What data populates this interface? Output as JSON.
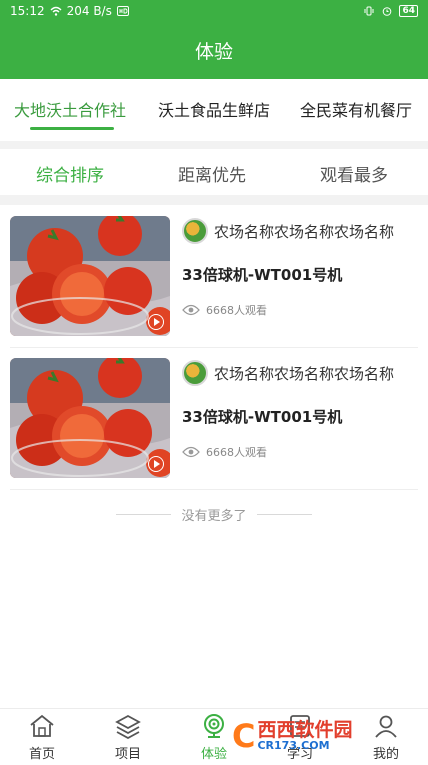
{
  "status_bar": {
    "time": "15:12",
    "network_speed": "204 B/s",
    "battery": "64"
  },
  "header": {
    "title": "体验"
  },
  "category_tabs": [
    {
      "label": "大地沃土合作社",
      "active": true
    },
    {
      "label": "沃土食品生鲜店",
      "active": false
    },
    {
      "label": "全民菜有机餐厅",
      "active": false
    }
  ],
  "sort_options": [
    {
      "label": "综合排序",
      "active": true
    },
    {
      "label": "距离优先",
      "active": false
    },
    {
      "label": "观看最多",
      "active": false
    }
  ],
  "cameras": [
    {
      "farm_name": "农场名称农场名称农场名称",
      "title": "33倍球机-WT001号机",
      "views": "6668人观看"
    },
    {
      "farm_name": "农场名称农场名称农场名称",
      "title": "33倍球机-WT001号机",
      "views": "6668人观看"
    }
  ],
  "list_end_text": "没有更多了",
  "bottom_nav": [
    {
      "label": "首页",
      "icon": "home-icon",
      "active": false
    },
    {
      "label": "项目",
      "icon": "layers-icon",
      "active": false
    },
    {
      "label": "体验",
      "icon": "camera-icon",
      "active": true
    },
    {
      "label": "学习",
      "icon": "book-icon",
      "active": false
    },
    {
      "label": "我的",
      "icon": "user-icon",
      "active": false
    }
  ],
  "watermark": {
    "main_text": "西西软件园",
    "sub_text": "CR173.COM"
  },
  "colors": {
    "brand_green": "#3cb043",
    "active_text_green": "#3a9b3e"
  }
}
